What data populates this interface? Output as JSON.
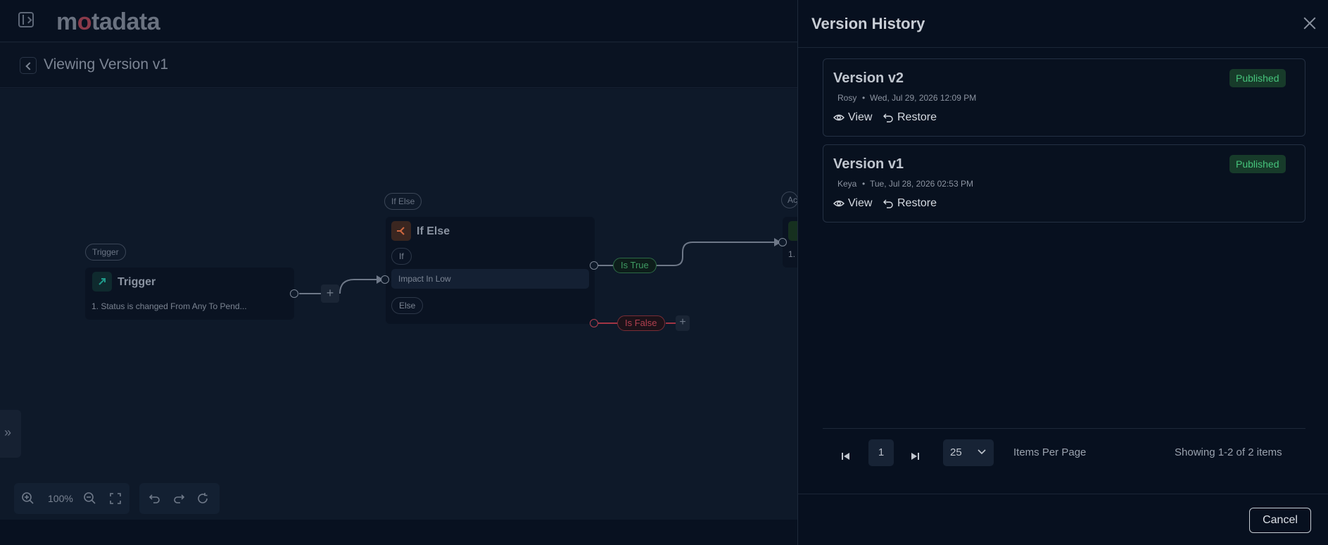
{
  "app": {
    "logo_prefix": "m",
    "logo_o": "o",
    "logo_suffix": "tadata"
  },
  "subheader": {
    "title": "Viewing Version v1"
  },
  "workflow": {
    "trigger": {
      "tag": "Trigger",
      "title": "Trigger",
      "description": "1. Status is changed From Any To Pend..."
    },
    "ifelse": {
      "tag": "If Else",
      "title": "If Else",
      "if_label": "If",
      "condition": "Impact In Low",
      "else_label": "Else"
    },
    "branches": {
      "true_label": "Is True",
      "false_label": "Is False"
    },
    "action": {
      "tag": "Ac",
      "text": "1."
    },
    "plus": "+"
  },
  "toolbar": {
    "zoom_level": "100%"
  },
  "drawer": {
    "title": "Version History",
    "versions": [
      {
        "name": "Version v2",
        "user": "Rosy",
        "date": "Wed, Jul 29, 2026 12:09 PM",
        "status": "Published",
        "view_label": "View",
        "restore_label": "Restore"
      },
      {
        "name": "Version v1",
        "user": "Keya",
        "date": "Tue, Jul 28, 2026 02:53 PM",
        "status": "Published",
        "view_label": "View",
        "restore_label": "Restore"
      }
    ],
    "pagination": {
      "current_page": "1",
      "page_size": "25",
      "items_per_page_label": "Items Per Page",
      "summary": "Showing 1-2 of 2 items"
    },
    "cancel_label": "Cancel"
  },
  "colors": {
    "published_badge_bg": "#173b2a",
    "published_badge_text": "#46c47c",
    "true_branch": "#3f9b63",
    "false_branch": "#b0404f"
  }
}
